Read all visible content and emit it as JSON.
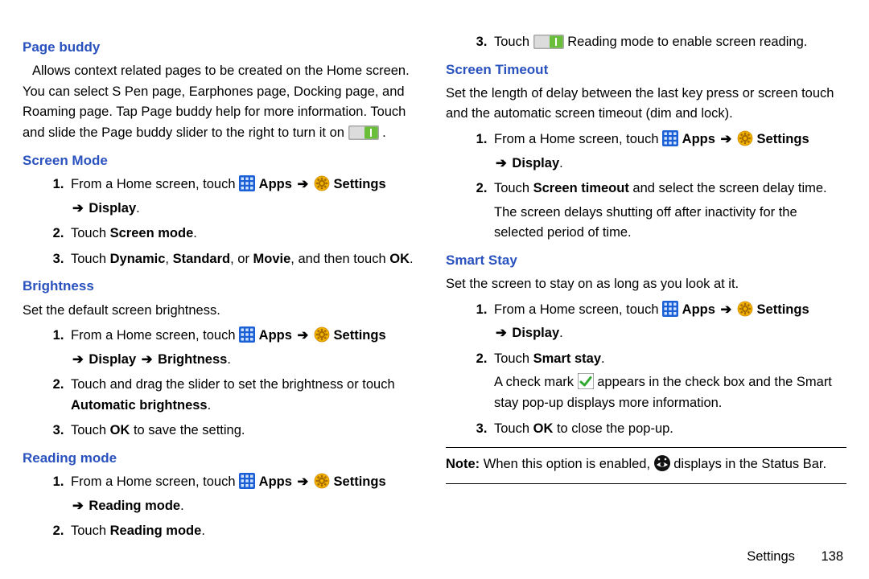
{
  "left": {
    "pageBuddy": {
      "title": "Page buddy",
      "desc": "Allows context related pages to be created on the Home screen. You can select S Pen page, Earphones page, Docking page, and Roaming page. Tap Page buddy help for more information. Touch and slide the Page buddy slider to the right to turn it on "
    },
    "screenMode": {
      "title": "Screen Mode",
      "step1_a": "From a Home screen, touch ",
      "step1_b": " Apps ",
      "step1_c": " Settings",
      "step1_d": " Display",
      "step2_a": "Touch ",
      "step2_b": "Screen mode",
      "step3_a": "Touch ",
      "step3_b": "Dynamic",
      "step3_c": "Standard",
      "step3_d": "Movie",
      "step3_e": ", and then touch ",
      "step3_f": "OK"
    },
    "brightness": {
      "title": "Brightness",
      "intro": "Set the default screen brightness.",
      "step1_a": "From a Home screen, touch ",
      "step1_b": " Apps ",
      "step1_c": " Settings",
      "step1_d": " Display ",
      "step1_e": " Brightness",
      "step2_a": "Touch and drag the slider to set the brightness or touch ",
      "step2_b": "Automatic brightness",
      "step3_a": "Touch ",
      "step3_b": "OK",
      "step3_c": " to save the setting."
    },
    "readingMode": {
      "title": "Reading mode",
      "step1_a": "From a Home screen, touch ",
      "step1_b": " Apps ",
      "step1_c": " Settings",
      "step1_d": " Reading mode",
      "step2_a": "Touch ",
      "step2_b": "Reading mode"
    }
  },
  "right": {
    "rmCont": {
      "step3_a": "Touch ",
      "step3_b": " Reading mode to enable screen reading."
    },
    "screenTimeout": {
      "title": "Screen Timeout",
      "intro": "Set the length of delay between the last key press or screen touch and the automatic screen timeout (dim and lock).",
      "step1_a": "From a Home screen, touch ",
      "step1_b": " Apps ",
      "step1_c": " Settings",
      "step1_d": " Display",
      "step2_a": "Touch ",
      "step2_b": "Screen timeout",
      "step2_c": " and select the screen delay time.",
      "step2_sub": "The screen delays shutting off after inactivity for the selected period of time."
    },
    "smartStay": {
      "title": "Smart Stay",
      "intro": "Set the screen to stay on as long as you look at it.",
      "step1_a": "From a Home screen, touch ",
      "step1_b": " Apps ",
      "step1_c": " Settings",
      "step1_d": " Display",
      "step2_a": "Touch ",
      "step2_b": "Smart stay",
      "step2_sub_a": "A check mark ",
      "step2_sub_b": " appears in the check box and the Smart stay pop-up displays more information.",
      "step3_a": "Touch ",
      "step3_b": "OK",
      "step3_c": " to close the pop-up."
    },
    "note": {
      "label": "Note:",
      "a": " When this option is enabled, ",
      "b": " displays in the Status Bar."
    }
  },
  "footer": {
    "section": "Settings",
    "page": "138"
  },
  "glyph": {
    "arrow": "➔",
    "period": "."
  }
}
